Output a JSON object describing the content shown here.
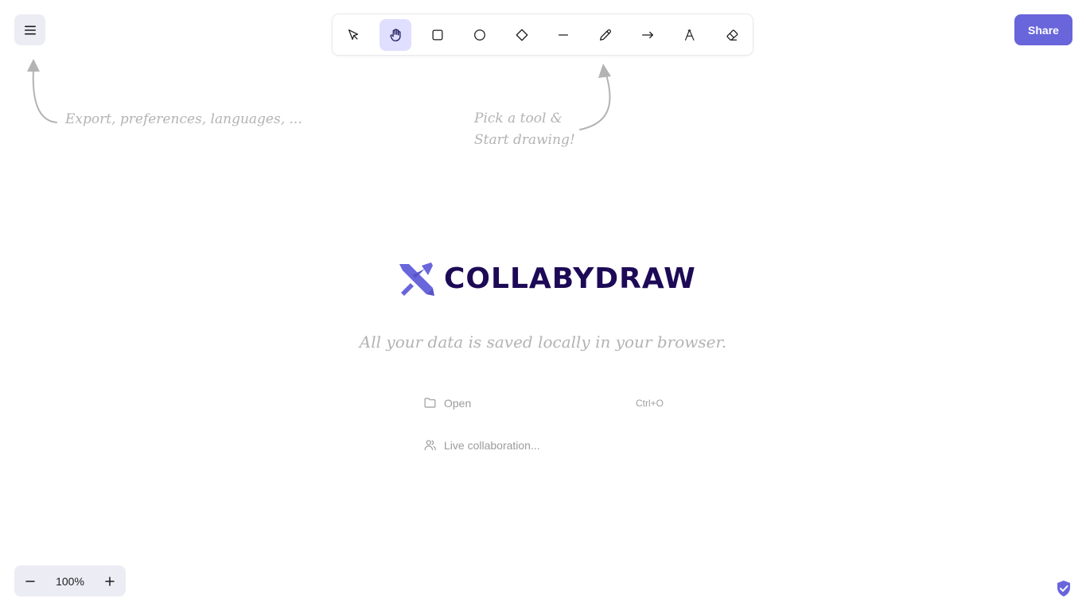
{
  "app": {
    "name": "COLLABYDRAW"
  },
  "menu": {
    "icon": "hamburger-menu-icon",
    "hint": "Export, preferences, languages, ..."
  },
  "toolbar": {
    "hint_line1": "Pick a tool &",
    "hint_line2": "Start drawing!",
    "active_tool": "hand",
    "tools": [
      {
        "name": "selection",
        "icon": "pointer-arrow-icon"
      },
      {
        "name": "hand",
        "icon": "hand-icon"
      },
      {
        "name": "rectangle",
        "icon": "square-icon"
      },
      {
        "name": "ellipse",
        "icon": "circle-icon"
      },
      {
        "name": "diamond",
        "icon": "diamond-icon"
      },
      {
        "name": "line",
        "icon": "line-icon"
      },
      {
        "name": "draw",
        "icon": "pencil-icon"
      },
      {
        "name": "arrow",
        "icon": "arrow-right-icon"
      },
      {
        "name": "text",
        "icon": "text-icon"
      },
      {
        "name": "eraser",
        "icon": "eraser-icon"
      }
    ]
  },
  "share": {
    "label": "Share"
  },
  "welcome": {
    "subtitle": "All your data is saved locally in your browser.",
    "items": [
      {
        "label": "Open",
        "shortcut": "Ctrl+O",
        "icon": "folder-icon"
      },
      {
        "label": "Live collaboration...",
        "shortcut": "",
        "icon": "users-icon"
      }
    ]
  },
  "zoom": {
    "level": "100%",
    "minus_icon": "minus-icon",
    "plus_icon": "plus-icon"
  },
  "colors": {
    "accent": "#6965db",
    "accent_light": "#e0dfff",
    "logo_text": "#1d0a56",
    "hint_text": "#b3b3b3",
    "panel_bg": "#ececf4"
  }
}
